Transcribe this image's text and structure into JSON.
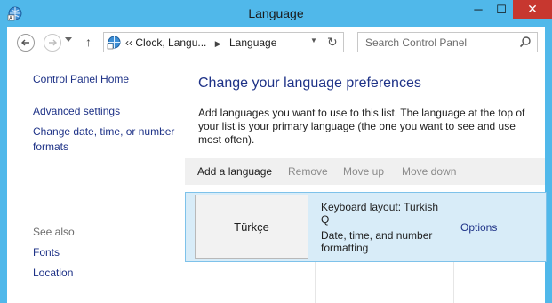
{
  "window": {
    "title": "Language",
    "min_label": "─",
    "max_label": "☐",
    "close_label": "✕"
  },
  "nav": {
    "back_icon": "arrow-left-icon",
    "forward_icon": "arrow-right-icon",
    "recent_icon": "chevron-down-icon",
    "up_label": "↑",
    "address": {
      "prefix": "‹‹",
      "crumb1": "Clock, Langu...",
      "sep": "▶",
      "crumb2": "Language",
      "dropdown": "▼",
      "refresh": "↻"
    },
    "search_placeholder": "Search Control Panel"
  },
  "sidebar": {
    "home": "Control Panel Home",
    "advanced": "Advanced settings",
    "date": "Change date, time, or number formats",
    "see_also": "See also",
    "fonts": "Fonts",
    "location": "Location"
  },
  "main": {
    "heading": "Change your language preferences",
    "intro": "Add languages you want to use to this list. The language at the top of your list is your primary language (the one you want to see and use most often).",
    "toolbar": {
      "add": "Add a language",
      "remove": "Remove",
      "move_up": "Move up",
      "move_down": "Move down"
    },
    "languages": [
      {
        "name": "Türkçe",
        "keyboard": "Keyboard layout: Turkish Q",
        "datetime": "Date, time, and number formatting",
        "options": "Options"
      }
    ]
  },
  "colors": {
    "frame": "#50b8ea",
    "link": "#1e3287",
    "selected_row": "#d8ecf8",
    "close": "#c7372f"
  }
}
